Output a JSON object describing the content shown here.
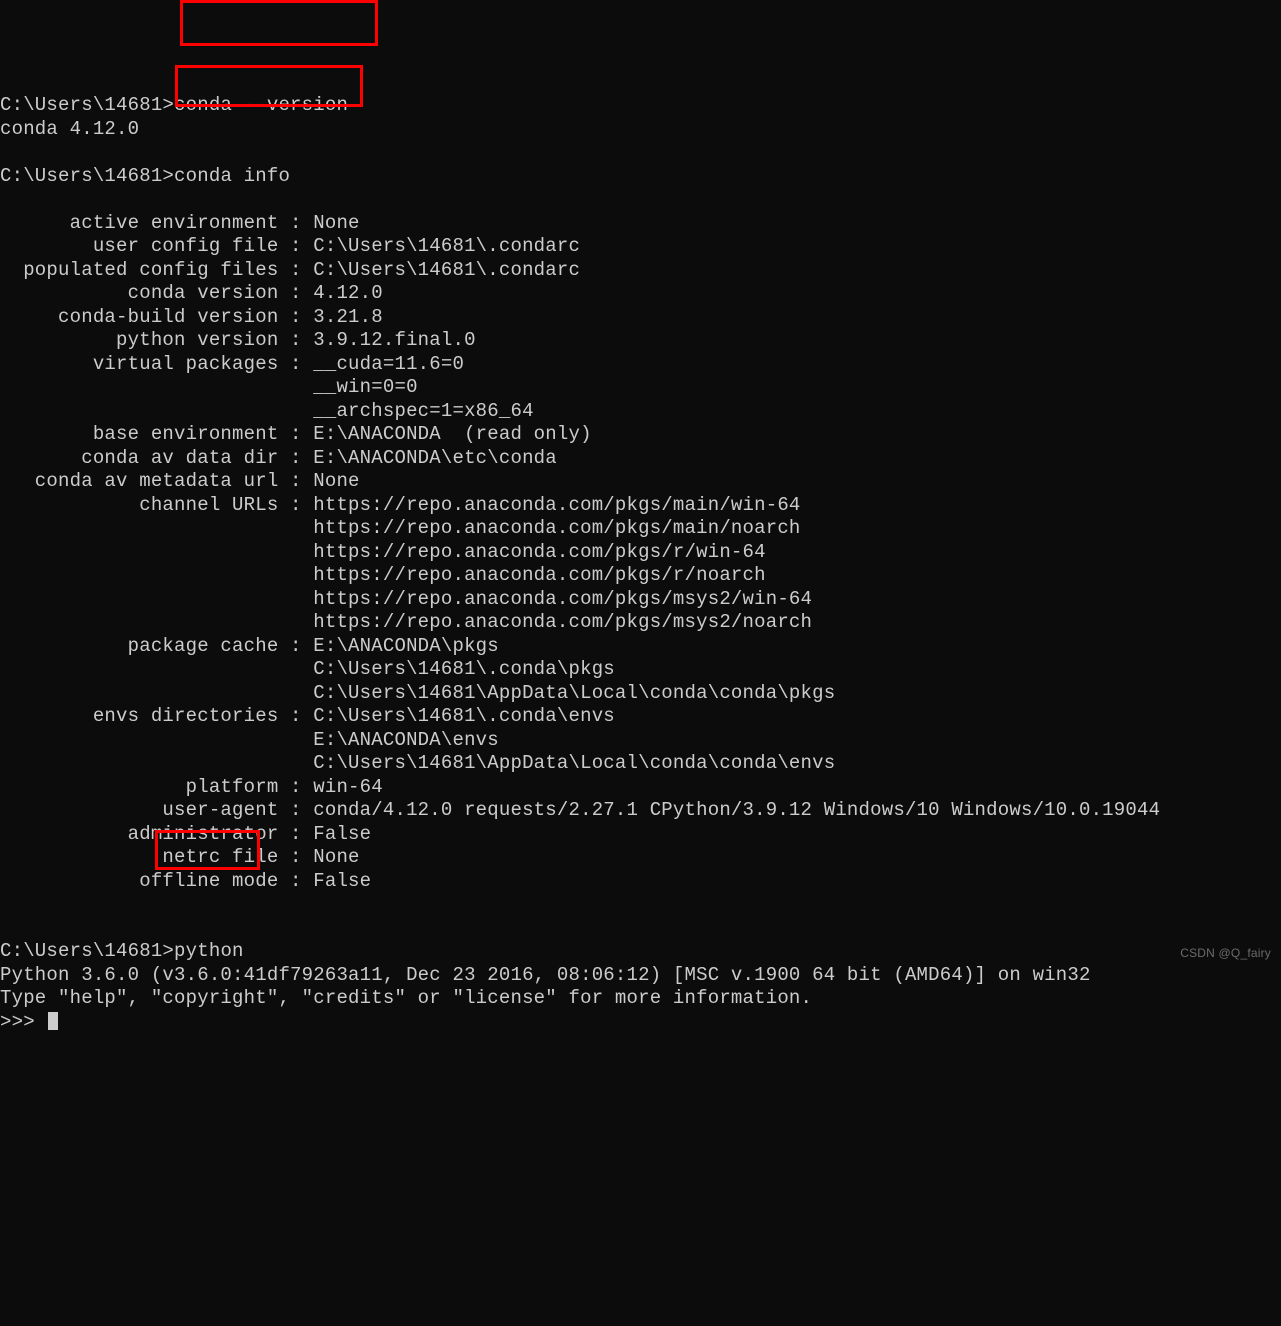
{
  "prompt1": {
    "path": "C:\\Users\\14681>",
    "command": "conda --version"
  },
  "output1": "conda 4.12.0",
  "prompt2": {
    "path": "C:\\Users\\14681>",
    "command": "conda info"
  },
  "info": {
    "rows": [
      {
        "label": "active environment",
        "value": "None"
      },
      {
        "label": "user config file",
        "value": "C:\\Users\\14681\\.condarc"
      },
      {
        "label": "populated config files",
        "value": "C:\\Users\\14681\\.condarc"
      },
      {
        "label": "conda version",
        "value": "4.12.0"
      },
      {
        "label": "conda-build version",
        "value": "3.21.8"
      },
      {
        "label": "python version",
        "value": "3.9.12.final.0"
      },
      {
        "label": "virtual packages",
        "value": "__cuda=11.6=0"
      },
      {
        "label": "",
        "value": "__win=0=0"
      },
      {
        "label": "",
        "value": "__archspec=1=x86_64"
      },
      {
        "label": "base environment",
        "value": "E:\\ANACONDA  (read only)"
      },
      {
        "label": "conda av data dir",
        "value": "E:\\ANACONDA\\etc\\conda"
      },
      {
        "label": "conda av metadata url",
        "value": "None"
      },
      {
        "label": "channel URLs",
        "value": "https://repo.anaconda.com/pkgs/main/win-64"
      },
      {
        "label": "",
        "value": "https://repo.anaconda.com/pkgs/main/noarch"
      },
      {
        "label": "",
        "value": "https://repo.anaconda.com/pkgs/r/win-64"
      },
      {
        "label": "",
        "value": "https://repo.anaconda.com/pkgs/r/noarch"
      },
      {
        "label": "",
        "value": "https://repo.anaconda.com/pkgs/msys2/win-64"
      },
      {
        "label": "",
        "value": "https://repo.anaconda.com/pkgs/msys2/noarch"
      },
      {
        "label": "package cache",
        "value": "E:\\ANACONDA\\pkgs"
      },
      {
        "label": "",
        "value": "C:\\Users\\14681\\.conda\\pkgs"
      },
      {
        "label": "",
        "value": "C:\\Users\\14681\\AppData\\Local\\conda\\conda\\pkgs"
      },
      {
        "label": "envs directories",
        "value": "C:\\Users\\14681\\.conda\\envs"
      },
      {
        "label": "",
        "value": "E:\\ANACONDA\\envs"
      },
      {
        "label": "",
        "value": "C:\\Users\\14681\\AppData\\Local\\conda\\conda\\envs"
      },
      {
        "label": "platform",
        "value": "win-64"
      },
      {
        "label": "user-agent",
        "value": "conda/4.12.0 requests/2.27.1 CPython/3.9.12 Windows/10 Windows/10.0.19044"
      },
      {
        "label": "administrator",
        "value": "False"
      },
      {
        "label": "netrc file",
        "value": "None"
      },
      {
        "label": "offline mode",
        "value": "False"
      }
    ],
    "label_width": 24
  },
  "prompt3": {
    "path": "C:\\Users\\14681>",
    "command": "python"
  },
  "python_banner": [
    "Python 3.6.0 (v3.6.0:41df79263a11, Dec 23 2016, 08:06:12) [MSC v.1900 64 bit (AMD64)] on win32",
    "Type \"help\", \"copyright\", \"credits\" or \"license\" for more information."
  ],
  "python_prompt": ">>> ",
  "watermark": "CSDN @Q_fairy"
}
